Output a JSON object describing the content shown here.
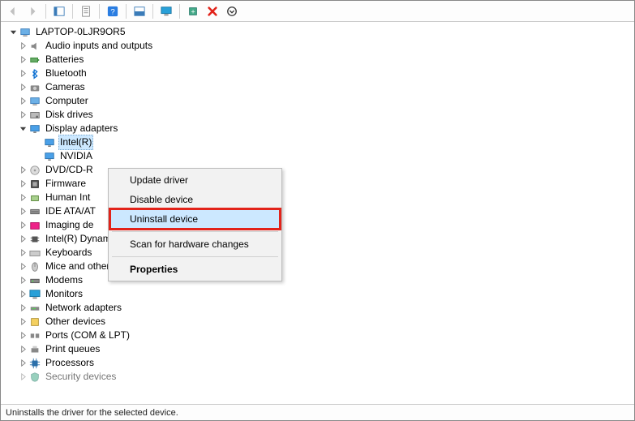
{
  "toolbar": {
    "items": [
      {
        "name": "back-icon",
        "interactable": false,
        "type": "arrow-left",
        "disabled": true
      },
      {
        "name": "forward-icon",
        "interactable": false,
        "type": "arrow-right",
        "disabled": true
      },
      {
        "sep": true
      },
      {
        "name": "show-hidden-icon",
        "interactable": true,
        "type": "panel"
      },
      {
        "sep": true
      },
      {
        "name": "properties-icon",
        "interactable": true,
        "type": "sheet"
      },
      {
        "sep": true
      },
      {
        "name": "help-icon",
        "interactable": true,
        "type": "help"
      },
      {
        "sep": true
      },
      {
        "name": "action-icon",
        "interactable": true,
        "type": "panel2"
      },
      {
        "sep": true
      },
      {
        "name": "update-icon",
        "interactable": true,
        "type": "monitor"
      },
      {
        "sep": true
      },
      {
        "name": "add-legacy-icon",
        "interactable": true,
        "type": "chip-plus"
      },
      {
        "name": "remove-icon",
        "interactable": true,
        "type": "red-x"
      },
      {
        "name": "scan-icon",
        "interactable": true,
        "type": "circle-down"
      }
    ]
  },
  "tree": {
    "root": {
      "label": "LAPTOP-0LJR9OR5",
      "icon": "computer",
      "expanded": true
    },
    "nodes": [
      {
        "label": "Audio inputs and outputs",
        "icon": "speaker",
        "expanded": false
      },
      {
        "label": "Batteries",
        "icon": "battery",
        "expanded": false
      },
      {
        "label": "Bluetooth",
        "icon": "bluetooth",
        "expanded": false
      },
      {
        "label": "Cameras",
        "icon": "camera",
        "expanded": false
      },
      {
        "label": "Computer",
        "icon": "computer",
        "expanded": false
      },
      {
        "label": "Disk drives",
        "icon": "disk",
        "expanded": false
      },
      {
        "label": "Display adapters",
        "icon": "display",
        "expanded": true,
        "children": [
          {
            "label": "Intel(R)",
            "icon": "display",
            "selected": true
          },
          {
            "label": "NVIDIA",
            "icon": "display"
          }
        ]
      },
      {
        "label": "DVD/CD-R",
        "icon": "dvd",
        "expanded": false,
        "truncated": true
      },
      {
        "label": "Firmware",
        "icon": "firmware",
        "expanded": false
      },
      {
        "label": "Human Int",
        "icon": "hid",
        "expanded": false,
        "truncated": true
      },
      {
        "label": "IDE ATA/AT",
        "icon": "ide",
        "expanded": false,
        "truncated": true
      },
      {
        "label": "Imaging de",
        "icon": "imaging",
        "expanded": false,
        "truncated": true
      },
      {
        "label": "Intel(R) Dynamic Platform and Thermal Framework",
        "icon": "chip",
        "expanded": false
      },
      {
        "label": "Keyboards",
        "icon": "keyboard",
        "expanded": false
      },
      {
        "label": "Mice and other pointing devices",
        "icon": "mouse",
        "expanded": false
      },
      {
        "label": "Modems",
        "icon": "modem",
        "expanded": false
      },
      {
        "label": "Monitors",
        "icon": "monitor",
        "expanded": false
      },
      {
        "label": "Network adapters",
        "icon": "network",
        "expanded": false
      },
      {
        "label": "Other devices",
        "icon": "other",
        "expanded": false
      },
      {
        "label": "Ports (COM & LPT)",
        "icon": "port",
        "expanded": false
      },
      {
        "label": "Print queues",
        "icon": "printer",
        "expanded": false
      },
      {
        "label": "Processors",
        "icon": "cpu",
        "expanded": false
      },
      {
        "label": "Security devices",
        "icon": "security",
        "expanded": false,
        "faded": true
      }
    ]
  },
  "context_menu": {
    "items": [
      {
        "label": "Update driver",
        "name": "ctx-update-driver"
      },
      {
        "label": "Disable device",
        "name": "ctx-disable-device"
      },
      {
        "label": "Uninstall device",
        "name": "ctx-uninstall-device",
        "highlighted": true
      },
      {
        "sep": true
      },
      {
        "label": "Scan for hardware changes",
        "name": "ctx-scan-hardware"
      },
      {
        "sep": true
      },
      {
        "label": "Properties",
        "name": "ctx-properties",
        "bold": true
      }
    ]
  },
  "statusbar": {
    "text": "Uninstalls the driver for the selected device."
  }
}
